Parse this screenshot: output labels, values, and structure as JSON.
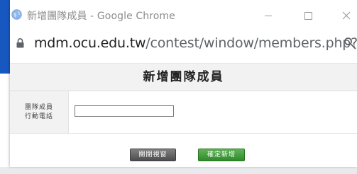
{
  "window": {
    "title": "新增團隊成員 - Google Chrome",
    "controls": {
      "minimize": "minimize-icon",
      "maximize": "maximize-icon",
      "close": "close-icon"
    }
  },
  "address_bar": {
    "host": "mdm.ocu.edu.tw",
    "path": "/contest/window/members.php?...",
    "icons": {
      "lock": "lock-icon",
      "key": "key-icon"
    }
  },
  "form": {
    "heading": "新增團隊成員",
    "phone_label_line1": "團隊成員",
    "phone_label_line2": "行動電話",
    "phone_value": ""
  },
  "buttons": {
    "close_window": "關閉視窗",
    "confirm_add": "確定新增"
  },
  "colors": {
    "page_accent": "#1757c0",
    "confirm_button": "#3a9a33",
    "close_button": "#5a5a5a"
  }
}
